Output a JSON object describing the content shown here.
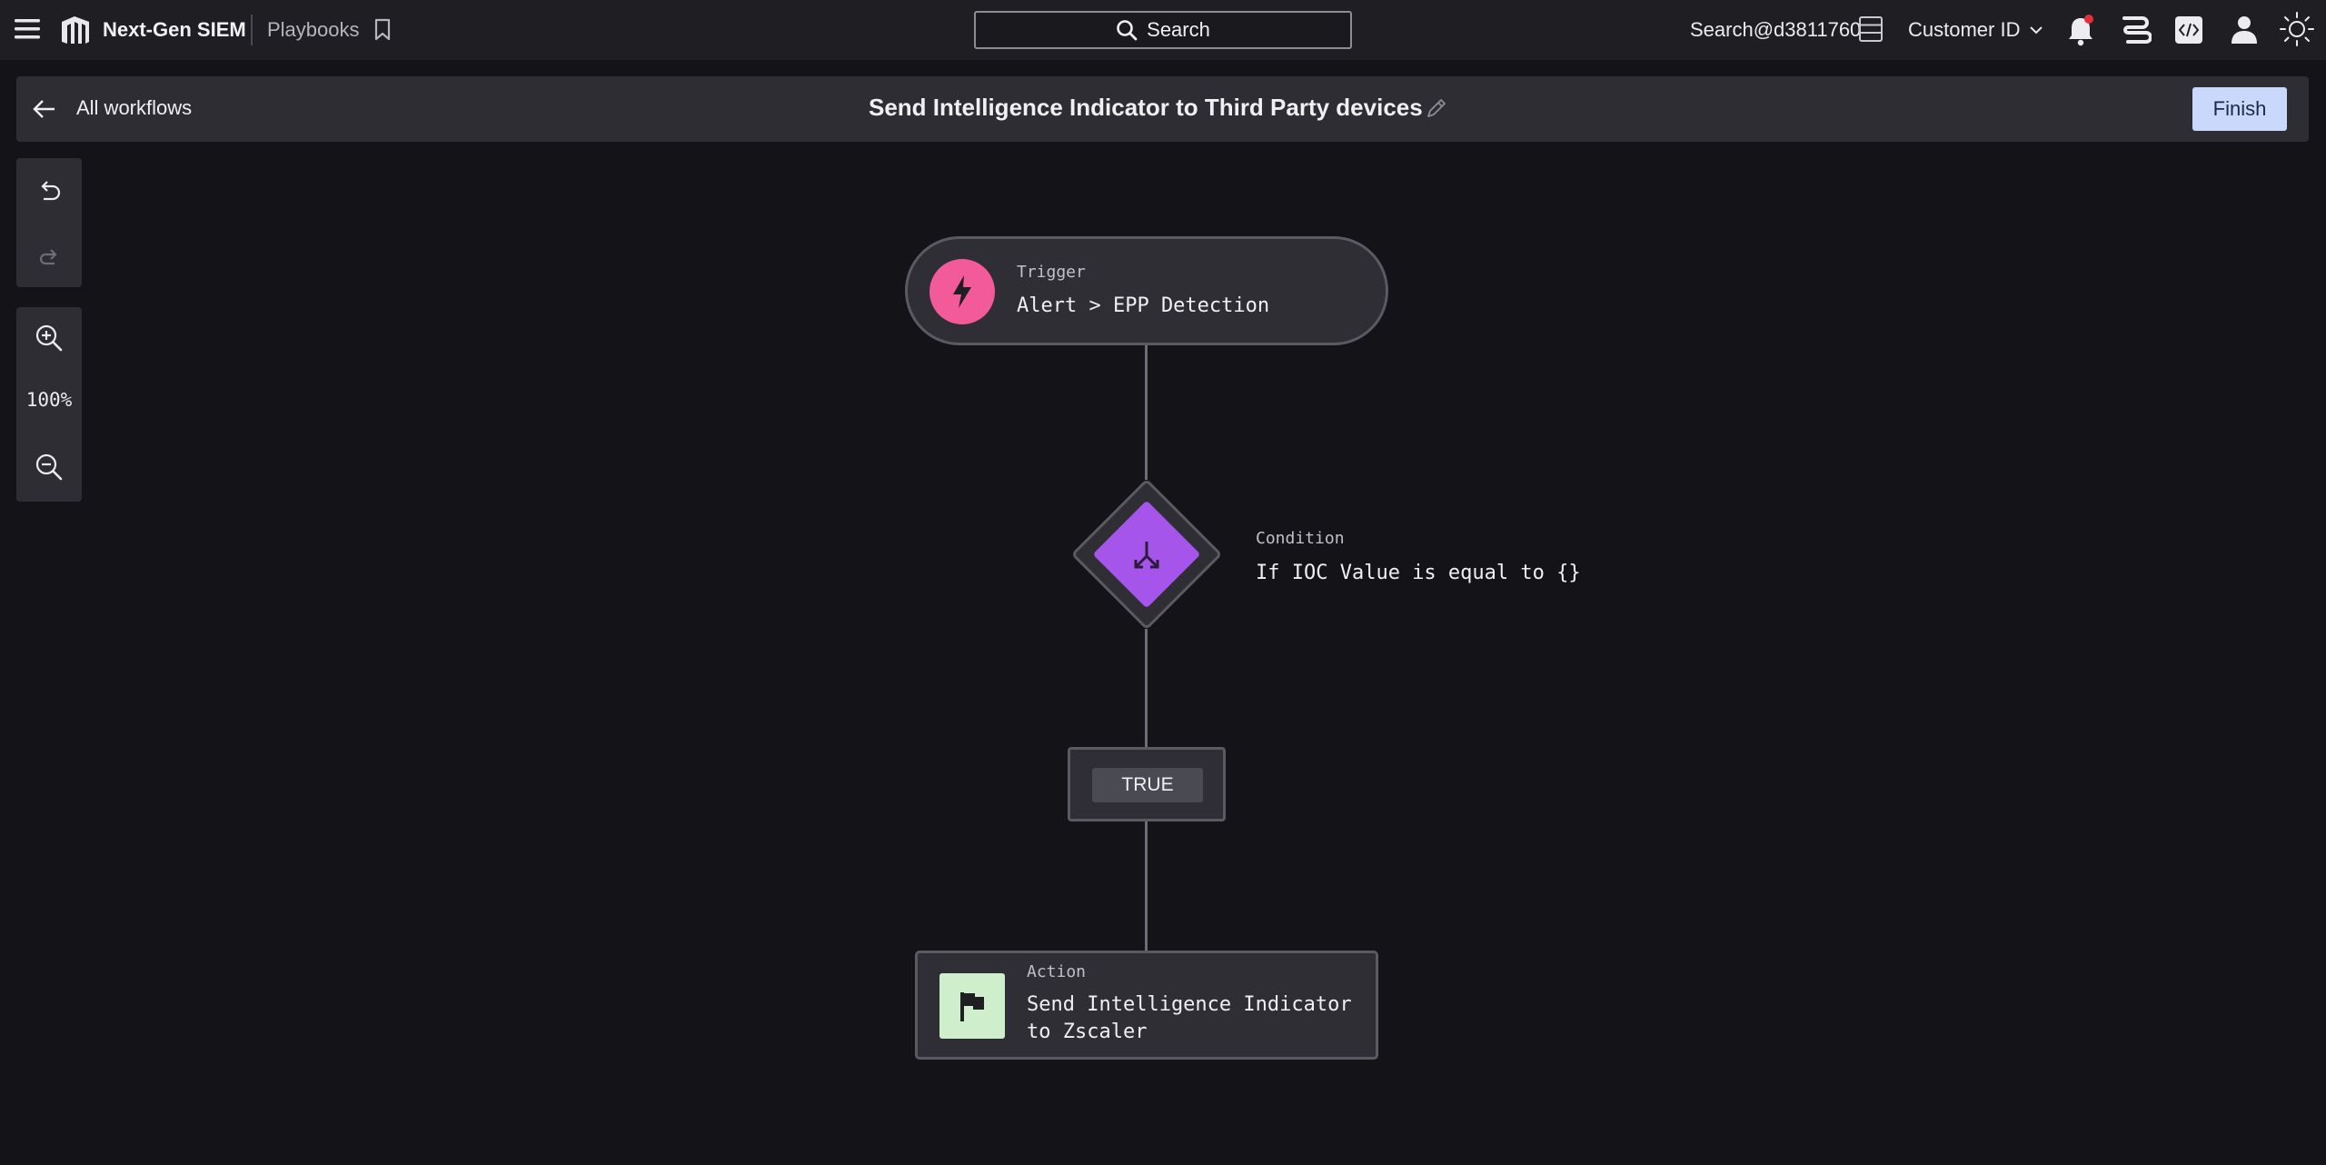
{
  "topbar": {
    "app_name": "Next-Gen SIEM",
    "breadcrumb": "Playbooks",
    "search_label": "Search",
    "user": "Search@d3811760",
    "customer_label": "Customer ID",
    "notification_dot_color": "#e0303a",
    "icons": [
      "menu-icon",
      "logo-icon",
      "bookmark-icon",
      "search-icon",
      "database-icon",
      "chevron-down-icon",
      "bell-icon",
      "stack-icon",
      "code-icon",
      "person-icon",
      "sun-icon"
    ]
  },
  "header": {
    "back_label": "All workflows",
    "title": "Send Intelligence Indicator to Third Party devices",
    "finish_label": "Finish"
  },
  "toolbar": {
    "zoom_level": "100%"
  },
  "flow": {
    "trigger": {
      "kind": "Trigger",
      "text": "Alert > EPP Detection",
      "color": "#f25a9a"
    },
    "condition": {
      "kind": "Condition",
      "text": "If IOC Value is equal to {}",
      "color": "#a555ea"
    },
    "branch": {
      "label": "TRUE"
    },
    "action": {
      "kind": "Action",
      "text_line1": "Send Intelligence Indicator",
      "text_line2": "to Zscaler",
      "color": "#cfeecb"
    }
  },
  "colors": {
    "background": "#141318",
    "topbar": "#1f1f23",
    "panel": "#2d2d33",
    "finish_button": "#c9d8fb"
  }
}
